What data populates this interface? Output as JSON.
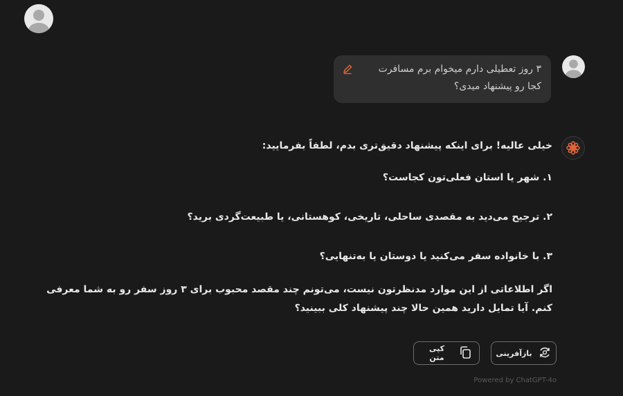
{
  "user_message": {
    "line1": "۳ روز تعطیلی دارم میخوام برم مسافرت",
    "line2": "کجا رو پیشنهاد میدی؟"
  },
  "assistant_message": {
    "greeting": "خیلی عالیه! برای اینکه پیشنهاد دقیق‌تری بدم، لطفاً بفرمایید:",
    "questions": [
      "۱. شهر یا استان فعلی‌تون کجاست؟",
      "۲. ترجیح می‌دید به مقصدی ساحلی، تاریخی، کوهستانی، یا طبیعت‌گردی برید؟",
      "۳. با خانواده سفر می‌کنید یا دوستان یا به‌تنهایی؟"
    ],
    "outro": "اگر اطلاعاتی از این موارد مدنظرتون نیست، می‌تونم چند مقصد محبوب برای ۳ روز سفر رو به شما معرفی کنم. آیا تمایل دارید همین حالا چند پیشنهاد کلی ببینید؟"
  },
  "actions": {
    "regenerate_label": "بازآفرینی",
    "copy_label": "کپی متن"
  },
  "footer": {
    "powered_by": "Powered by ChatGPT-4o"
  },
  "icons": {
    "avatar": "user-avatar-icon",
    "edit": "pencil-icon",
    "bot": "flower-logo-icon",
    "regenerate": "regenerate-icon",
    "copy": "copy-icon"
  },
  "colors": {
    "background": "#1a1a1a",
    "bubble": "#2f2f2f",
    "accent": "#e0653a"
  }
}
